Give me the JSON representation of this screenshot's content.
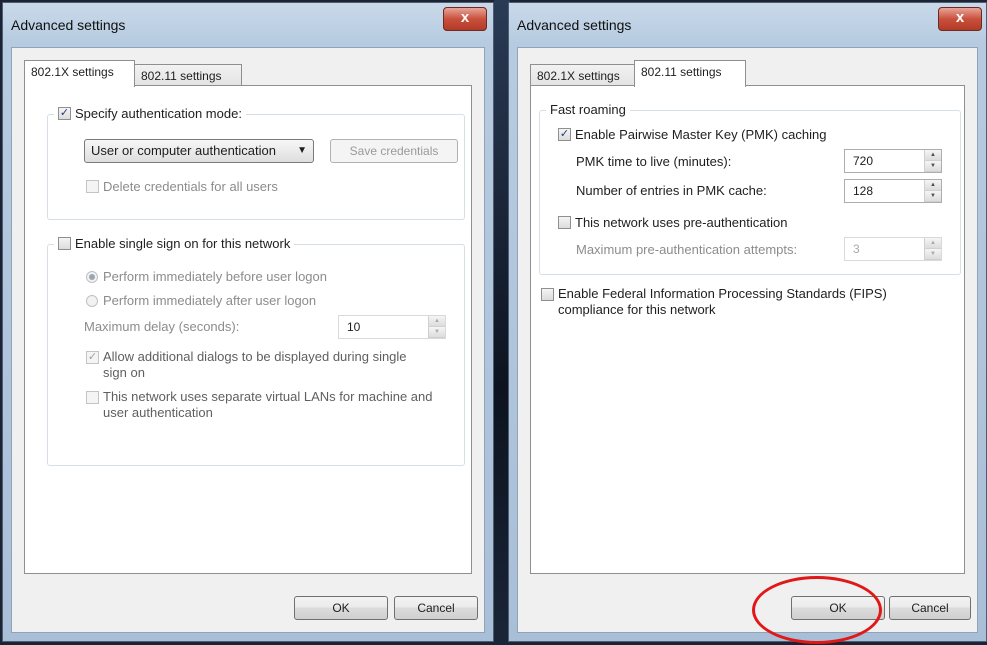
{
  "left_dialog": {
    "title": "Advanced settings",
    "close_label": "x",
    "tabs": [
      "802.1X settings",
      "802.11 settings"
    ],
    "specify_auth_mode_label": "Specify authentication mode:",
    "auth_mode_selected": "User or computer authentication",
    "save_credentials_label": "Save credentials",
    "delete_credentials_label": "Delete credentials for all users",
    "sso_label": "Enable single sign on for this network",
    "perform_before_label": "Perform immediately before user logon",
    "perform_after_label": "Perform immediately after user logon",
    "max_delay_label": "Maximum delay (seconds):",
    "max_delay_value": "10",
    "allow_dialogs_label": "Allow additional dialogs to be displayed during single sign on",
    "separate_vlans_label": "This network uses separate virtual LANs for machine and user authentication",
    "ok_label": "OK",
    "cancel_label": "Cancel"
  },
  "right_dialog": {
    "title": "Advanced settings",
    "close_label": "x",
    "tabs": [
      "802.1X settings",
      "802.11 settings"
    ],
    "fast_roaming_label": "Fast roaming",
    "pmk_caching_label": "Enable Pairwise Master Key (PMK) caching",
    "pmk_ttl_label": "PMK time to live (minutes):",
    "pmk_ttl_value": "720",
    "pmk_entries_label": "Number of entries in PMK cache:",
    "pmk_entries_value": "128",
    "preauth_label": "This network uses pre-authentication",
    "max_preauth_label": "Maximum pre-authentication attempts:",
    "max_preauth_value": "3",
    "fips_label": "Enable Federal Information Processing Standards (FIPS) compliance for this network",
    "ok_label": "OK",
    "cancel_label": "Cancel"
  },
  "colors": {
    "highlight_circle": "#e11818",
    "title_bar": "#b7cbe0",
    "close_button": "#c9503c"
  }
}
